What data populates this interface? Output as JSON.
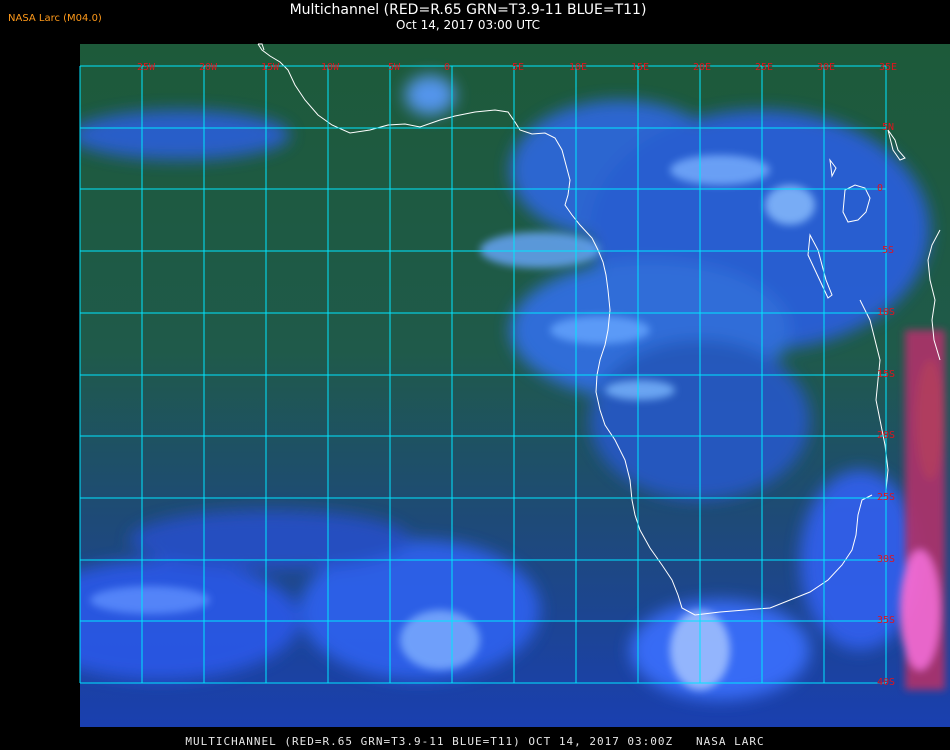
{
  "header": {
    "title": "Multichannel (RED=R.65 GRN=T3.9-11 BLUE=T11)",
    "datetime": "Oct 14, 2017 03:00 UTC"
  },
  "brand": "NASA Larc (M04.0)",
  "footer": "MULTICHANNEL (RED=R.65 GRN=T3.9-11 BLUE=T11) OCT 14, 2017 03:00Z   NASA LARC",
  "map": {
    "colors": {
      "grid": "#00e5ff",
      "coast": "#ffffff",
      "tick_label": "#e0141c"
    },
    "lon_labels": [
      "25W",
      "20W",
      "15W",
      "10W",
      "5W",
      "0",
      "5E",
      "10E",
      "15E",
      "20E",
      "25E",
      "30E",
      "35E"
    ],
    "lat_labels": [
      "5N",
      "0",
      "5S",
      "10S",
      "15S",
      "20S",
      "25S",
      "30S",
      "35S",
      "40S"
    ]
  }
}
